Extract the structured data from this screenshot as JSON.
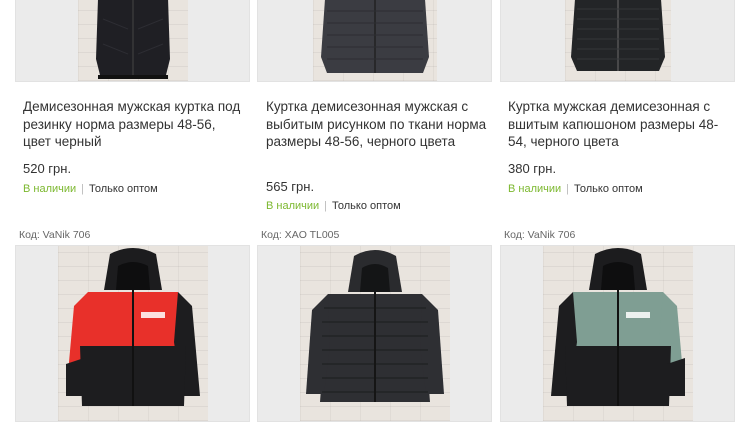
{
  "products_top": [
    {
      "title": "Демисезонная мужская куртка под резинку норма размеры 48-56, цвет черный",
      "price": "520 грн.",
      "availability": "В наличии",
      "sale_type": "Только оптом"
    },
    {
      "title": "Куртка демисезонная мужская с выбитым рисунком по ткани норма размеры 48-56, черного цвета",
      "price": "565 грн.",
      "availability": "В наличии",
      "sale_type": "Только оптом"
    },
    {
      "title": "Куртка мужская демисезонная с вшитым капюшоном размеры 48-54, черного цвета",
      "price": "380 грн.",
      "availability": "В наличии",
      "sale_type": "Только оптом"
    }
  ],
  "products_bottom": [
    {
      "code": "Код: VaNik 706",
      "image": "red-black-hooded-jacket"
    },
    {
      "code": "Код: XAO TL005",
      "image": "black-quilted-hooded-jacket"
    },
    {
      "code": "Код: VaNik 706",
      "image": "green-black-hooded-jacket"
    }
  ],
  "colors": {
    "in_stock": "#7cb82f",
    "text": "#333333",
    "code_text": "#666666",
    "image_bg": "#ebebeb"
  }
}
